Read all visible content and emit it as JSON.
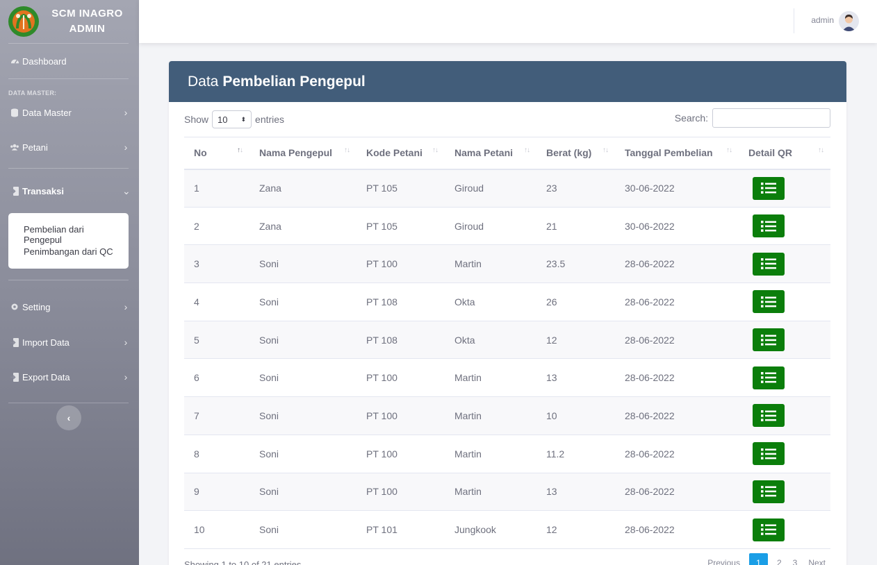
{
  "app": {
    "brand": "SCM INAGRO ADMIN",
    "brand_line1": "SCM INAGRO",
    "brand_line2": "ADMIN"
  },
  "sidebar": {
    "dashboard": "Dashboard",
    "section_master": "DATA MASTER:",
    "items": [
      {
        "label": "Data Master",
        "icon": "database-icon"
      },
      {
        "label": "Petani",
        "icon": "users-icon"
      },
      {
        "label": "Transaksi",
        "icon": "file-import-icon",
        "expanded": true
      },
      {
        "label": "Setting",
        "icon": "gear-icon"
      },
      {
        "label": "Import Data",
        "icon": "file-import-icon"
      },
      {
        "label": "Export Data",
        "icon": "file-export-icon"
      }
    ],
    "submenu": [
      "Pembelian dari Pengepul",
      "Penimbangan dari QC"
    ]
  },
  "topbar": {
    "user": "admin"
  },
  "page": {
    "title_prefix": "Data",
    "title_bold": "Pembelian Pengepul"
  },
  "table_controls": {
    "show_label": "Show",
    "entries_value": "10",
    "entries_label": "entries",
    "search_label": "Search:",
    "search_value": ""
  },
  "table": {
    "columns": [
      "No",
      "Nama Pengepul",
      "Kode Petani",
      "Nama Petani",
      "Berat (kg)",
      "Tanggal Pembelian",
      "Detail QR"
    ],
    "rows": [
      [
        "1",
        "Zana",
        "PT 105",
        "Giroud",
        "23",
        "30-06-2022"
      ],
      [
        "2",
        "Zana",
        "PT 105",
        "Giroud",
        "21",
        "30-06-2022"
      ],
      [
        "3",
        "Soni",
        "PT 100",
        "Martin",
        "23.5",
        "28-06-2022"
      ],
      [
        "4",
        "Soni",
        "PT 108",
        "Okta",
        "26",
        "28-06-2022"
      ],
      [
        "5",
        "Soni",
        "PT 108",
        "Okta",
        "12",
        "28-06-2022"
      ],
      [
        "6",
        "Soni",
        "PT 100",
        "Martin",
        "13",
        "28-06-2022"
      ],
      [
        "7",
        "Soni",
        "PT 100",
        "Martin",
        "10",
        "28-06-2022"
      ],
      [
        "8",
        "Soni",
        "PT 100",
        "Martin",
        "11.2",
        "28-06-2022"
      ],
      [
        "9",
        "Soni",
        "PT 100",
        "Martin",
        "13",
        "28-06-2022"
      ],
      [
        "10",
        "Soni",
        "PT 101",
        "Jungkook",
        "12",
        "28-06-2022"
      ]
    ]
  },
  "footer": {
    "info": "Showing 1 to 10 of 21 entries",
    "previous": "Previous",
    "pages": [
      "1",
      "2",
      "3"
    ],
    "next": "Next"
  },
  "colors": {
    "header": "#425d7a",
    "qr_button": "#0b7e0b",
    "page_active": "#1a9ee6"
  }
}
